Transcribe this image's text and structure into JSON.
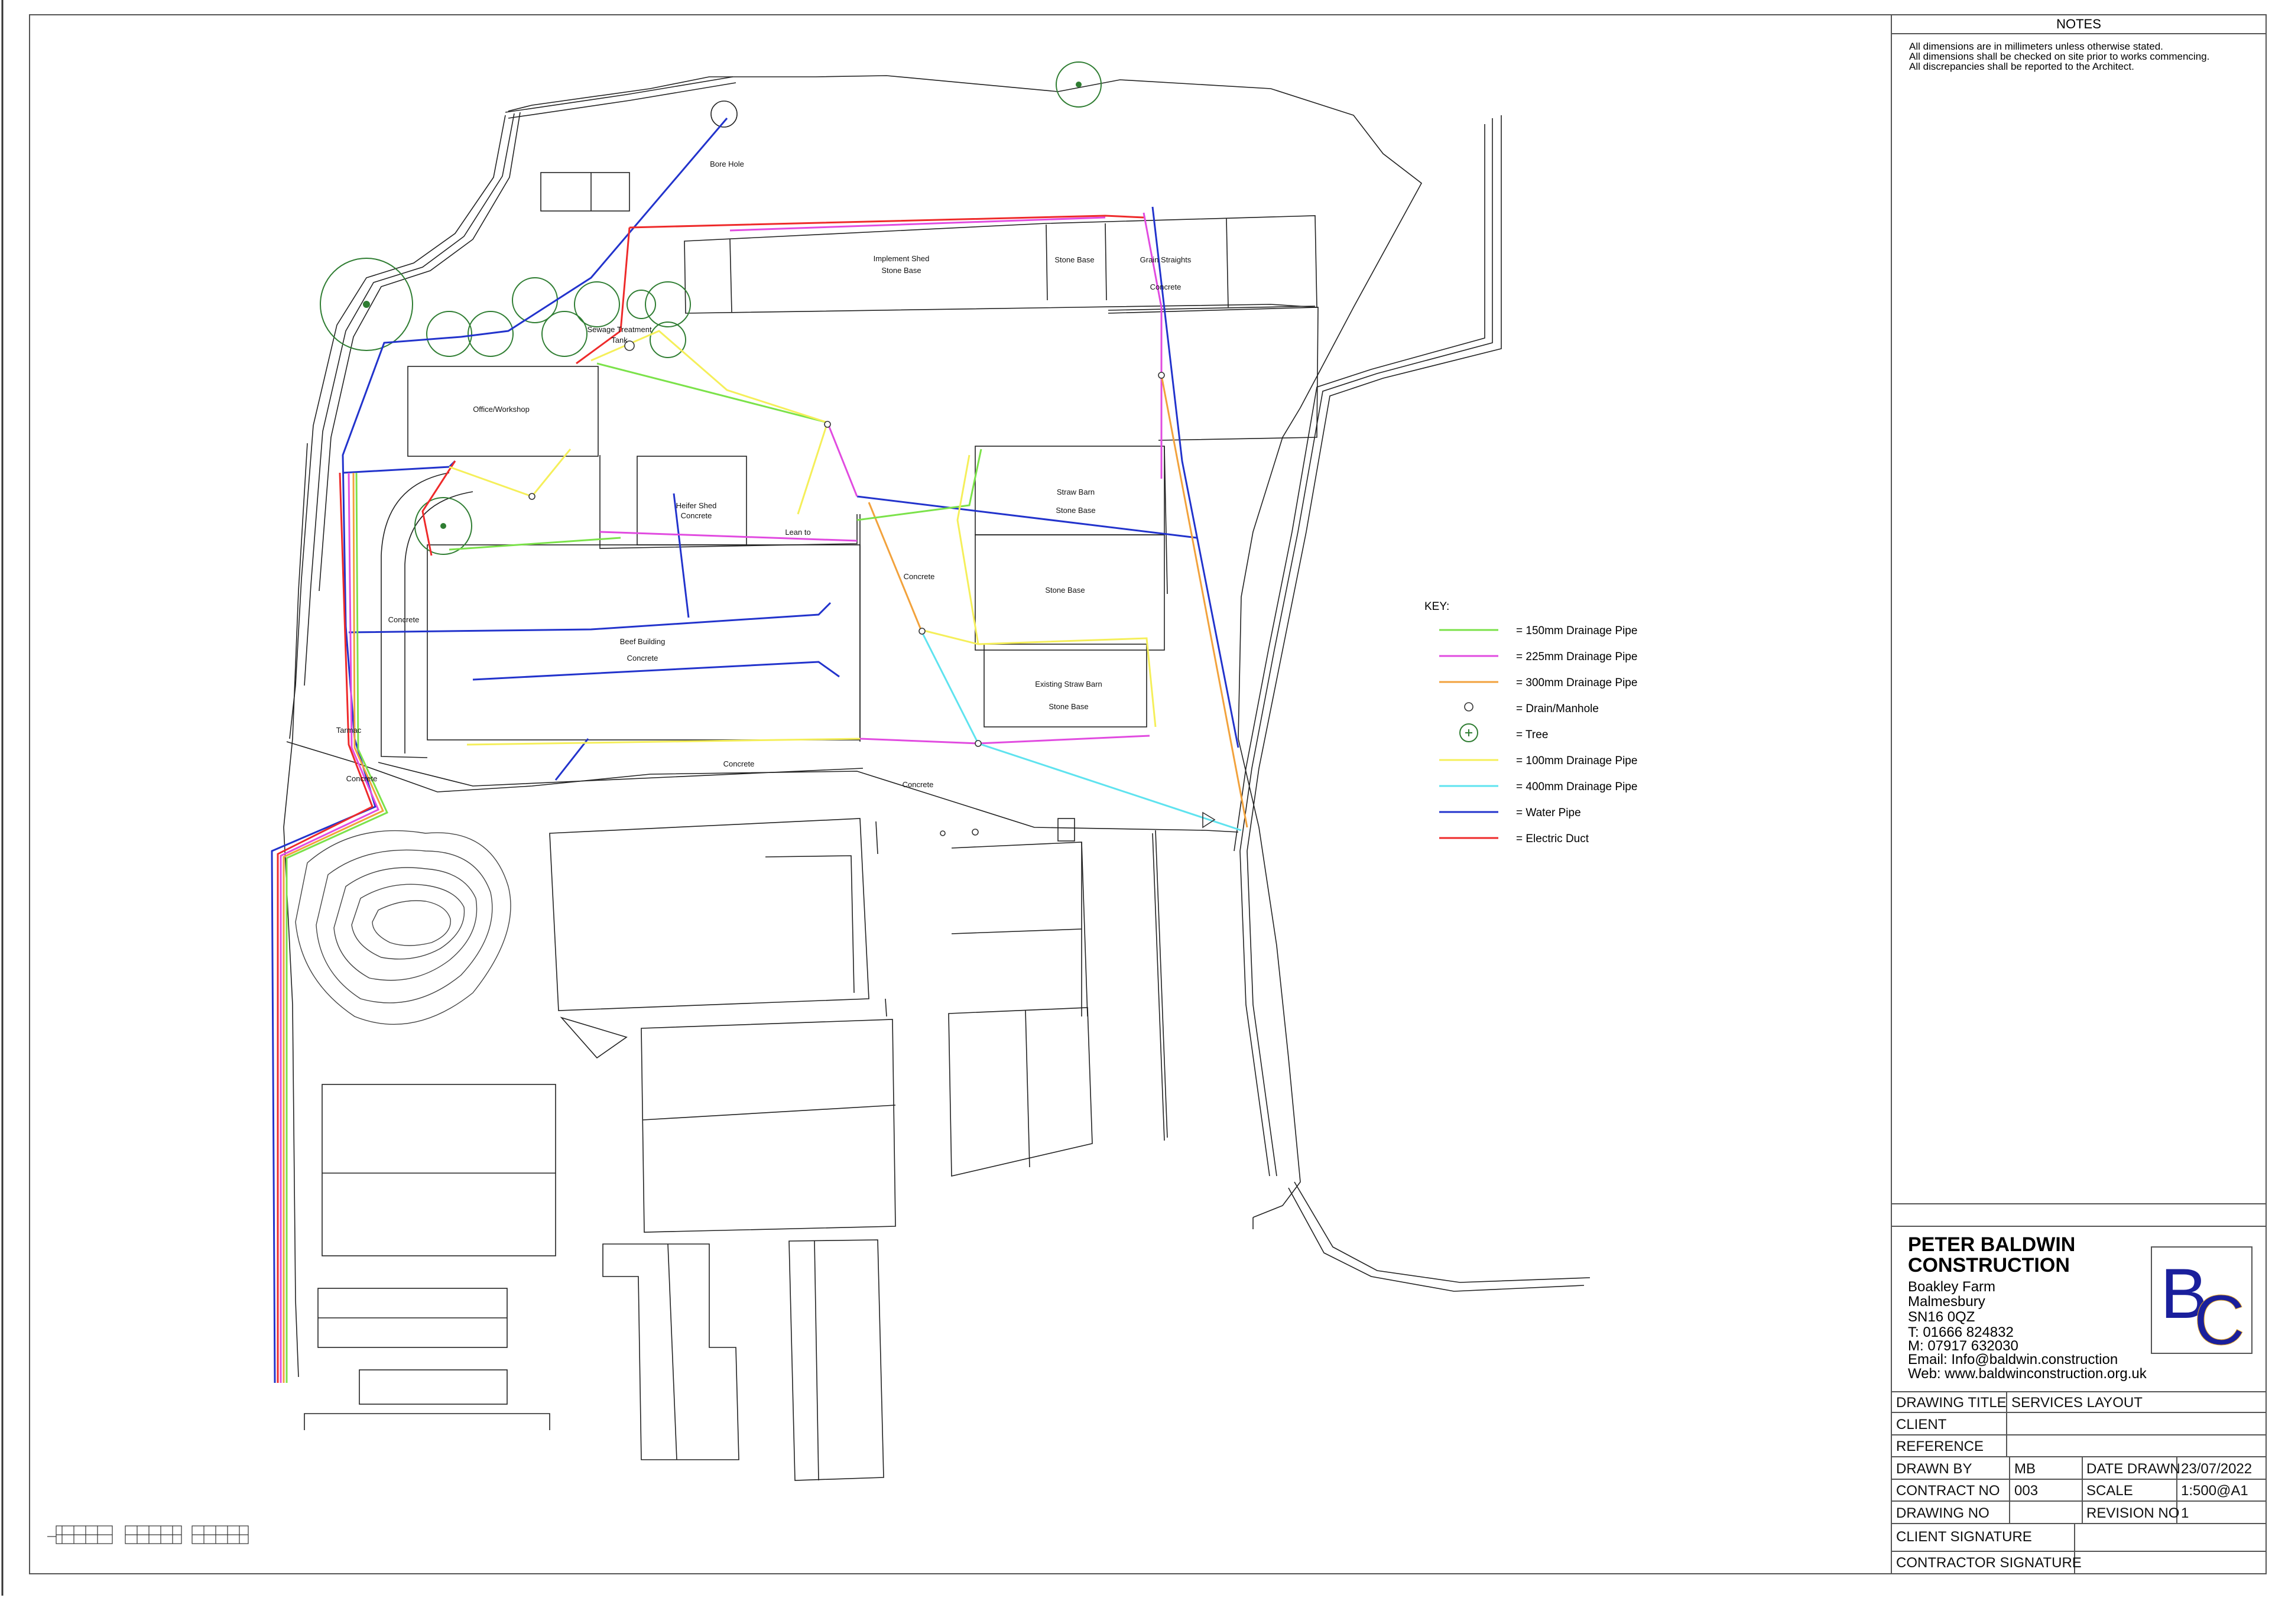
{
  "notes": {
    "heading": "NOTES",
    "lines": [
      "All dimensions are in millimeters unless otherwise stated.",
      "All dimensions shall be checked on site prior to works commencing.",
      "All discrepancies shall be reported to the Architect."
    ]
  },
  "plan_labels": {
    "bore_hole": "Bore Hole",
    "implement_shed": "Implement Shed",
    "implement_shed_base": "Stone Base",
    "stone_base_1": "Stone Base",
    "grain_straights": "Grain Straights",
    "grain_straights_base": "Concrete",
    "sewage_treatment_1": "Sewage Treatment",
    "sewage_treatment_2": "Tank",
    "office_workshop": "Office/Workshop",
    "heifer_shed": "Heifer Shed",
    "heifer_shed_base": "Concrete",
    "lean_to": "Lean to",
    "straw_barn": "Straw Barn",
    "straw_barn_base": "Stone Base",
    "concrete_mid": "Concrete",
    "stone_base_2": "Stone Base",
    "concrete_left": "Concrete",
    "beef_building": "Beef Building",
    "beef_building_base": "Concrete",
    "existing_straw_barn": "Existing Straw Barn",
    "existing_straw_barn_base": "Stone Base",
    "tarmac": "Tarmac",
    "concrete_yard_1": "Concrete",
    "concrete_yard_2": "Concrete",
    "concrete_yard_3": "Concrete"
  },
  "key": {
    "heading": "KEY:",
    "items": [
      {
        "symbol": "line",
        "color": "#7be24a",
        "label": "= 150mm Drainage Pipe"
      },
      {
        "symbol": "line",
        "color": "#e14be0",
        "label": "= 225mm Drainage Pipe"
      },
      {
        "symbol": "line",
        "color": "#f2a23c",
        "label": "= 300mm Drainage Pipe"
      },
      {
        "symbol": "circle",
        "color": "#333333",
        "label": "= Drain/Manhole"
      },
      {
        "symbol": "tree",
        "color": "#2f7d32",
        "label": "= Tree"
      },
      {
        "symbol": "line",
        "color": "#f5ef5a",
        "label": "= 100mm Drainage Pipe"
      },
      {
        "symbol": "line",
        "color": "#5fe3ef",
        "label": "= 400mm Drainage Pipe"
      },
      {
        "symbol": "line",
        "color": "#2233cc",
        "label": "= Water Pipe"
      },
      {
        "symbol": "line",
        "color": "#ee2a2a",
        "label": "= Electric Duct"
      }
    ]
  },
  "company": {
    "name_1": "PETER BALDWIN",
    "name_2": "CONSTRUCTION",
    "address": [
      "Boakley Farm",
      "Malmesbury",
      "SN16 0QZ"
    ],
    "phone": "T: 01666 824832",
    "mobile": "M: 07917 632030",
    "email": "Email: Info@baldwin.construction",
    "web": "Web: www.baldwinconstruction.org.uk",
    "logo_letters": "BC",
    "logo_color": "#1a1f9c",
    "logo_accent": "#e0a020"
  },
  "title_block": {
    "drawing_title_label": "DRAWING TITLE",
    "drawing_title_value": "SERVICES LAYOUT",
    "client_label": "CLIENT",
    "client_value": "",
    "reference_label": "REFERENCE",
    "reference_value": "",
    "drawn_by_label": "DRAWN BY",
    "drawn_by_value": "MB",
    "date_drawn_label": "DATE DRAWN",
    "date_drawn_value": "23/07/2022",
    "contract_no_label": "CONTRACT NO",
    "contract_no_value": "003",
    "scale_label": "SCALE",
    "scale_value": "1:500@A1",
    "drawing_no_label": "DRAWING NO",
    "drawing_no_value": "",
    "revision_no_label": "REVISION NO",
    "revision_no_value": "1",
    "client_signature_label": "CLIENT SIGNATURE",
    "contractor_signature_label": "CONTRACTOR SIGNATURE"
  }
}
